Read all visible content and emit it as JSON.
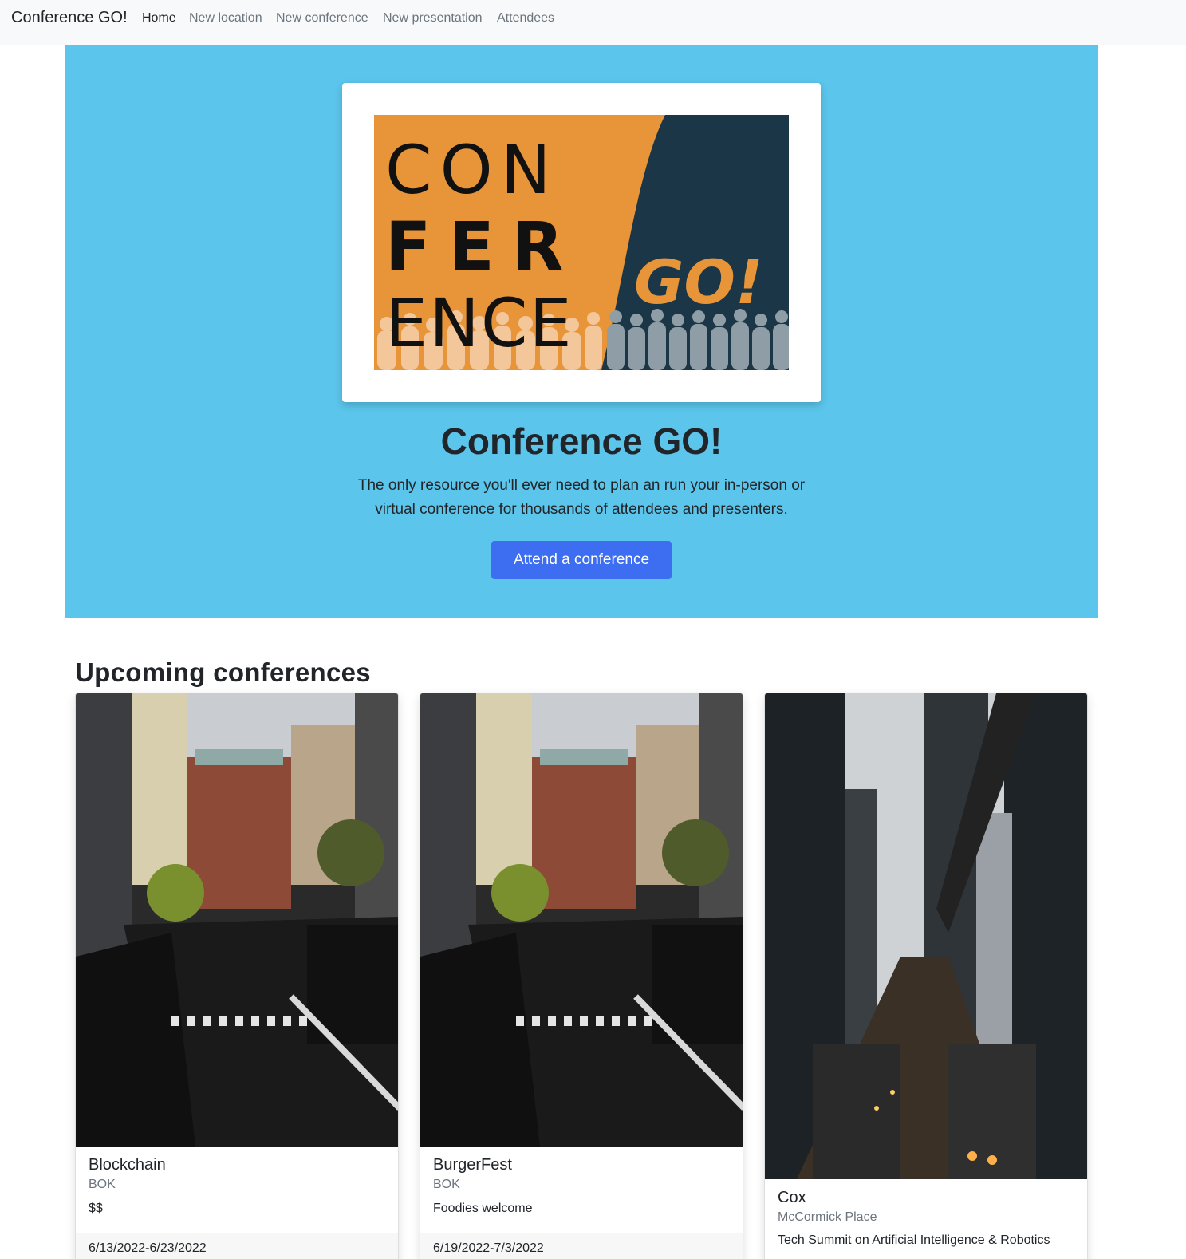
{
  "navbar": {
    "brand": "Conference GO!",
    "links": [
      "Home",
      "New location",
      "New conference",
      "New presentation",
      "Attendees"
    ],
    "active_link": "Home"
  },
  "hero": {
    "logo": {
      "line1": "CON",
      "line2": "FER",
      "line3": "ENCE",
      "go": "GO!"
    },
    "title": "Conference GO!",
    "lead": "The only resource you'll ever need to plan an run your in-person or virtual conference for thousands of attendees and presenters.",
    "button": "Attend a conference"
  },
  "upcoming": {
    "heading": "Upcoming conferences",
    "cards": [
      {
        "name": "Blockchain",
        "location": "BOK",
        "description": "$$",
        "dates": "6/13/2022-6/23/2022",
        "image": "city-street-photo"
      },
      {
        "name": "BurgerFest",
        "location": "BOK",
        "description": "Foodies welcome",
        "dates": "6/19/2022-7/3/2022",
        "image": "city-street-photo"
      },
      {
        "name": "Cox",
        "location": "McCormick Place",
        "description": "Tech Summit on Artificial Intelligence & Robotics",
        "dates": "",
        "image": "elevated-train-photo"
      }
    ]
  },
  "colors": {
    "navbar_bg": "#f8f9fa",
    "hero_bg": "#5bc5eb",
    "primary_button": "#3d6ef2",
    "logo_orange": "#e8953a",
    "logo_navy": "#1b3647"
  }
}
